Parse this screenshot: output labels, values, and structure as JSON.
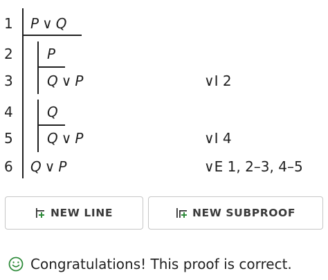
{
  "proof": {
    "lines": [
      {
        "num": "1",
        "left": "P",
        "op": "∨",
        "right": "Q",
        "rule": ""
      },
      {
        "num": "2",
        "left": "P",
        "op": "",
        "right": "",
        "rule": ""
      },
      {
        "num": "3",
        "left": "Q",
        "op": "∨",
        "right": "P",
        "rule": "∨I 2"
      },
      {
        "num": "4",
        "left": "Q",
        "op": "",
        "right": "",
        "rule": ""
      },
      {
        "num": "5",
        "left": "Q",
        "op": "∨",
        "right": "P",
        "rule": "∨I 4"
      },
      {
        "num": "6",
        "left": "Q",
        "op": "∨",
        "right": "P",
        "rule": "∨E 1, 2–3, 4–5"
      }
    ]
  },
  "buttons": {
    "new_line": "NEW LINE",
    "new_subproof": "NEW SUBPROOF"
  },
  "status": {
    "message": "Congratulations! This proof is correct.",
    "icon": "smiley-icon"
  },
  "colors": {
    "icon_green": "#2e8b3a",
    "text": "#1f1f1f"
  }
}
